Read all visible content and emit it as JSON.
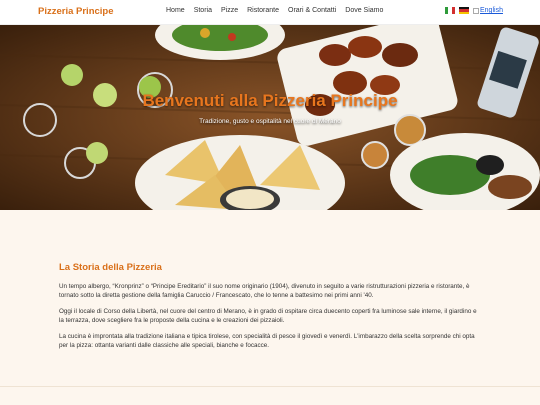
{
  "header": {
    "brand": "Pizzeria Principe",
    "nav": [
      "Home",
      "Storia",
      "Pizze",
      "Ristorante",
      "Orari & Contatti",
      "Dove Siamo"
    ],
    "lang_english": "English"
  },
  "hero": {
    "title": "Benvenuti alla Pizzeria Principe",
    "subtitle": "Tradizione, gusto e ospitalità nel cuore di Merano"
  },
  "story": {
    "title": "La Storia della Pizzeria",
    "paragraphs": [
      "Un tempo albergo, “Kronprinz” o “Principe Ereditario” il suo nome originario (1904), divenuto in seguito a varie ristrutturazioni pizzeria e ristorante, è tornato sotto la diretta gestione della famiglia Caruccio / Francescato, che lo tenne a battesimo nei primi anni '40.",
      "Oggi il locale di Corso della Libertà, nel cuore del centro di Merano, è in grado di ospitare circa duecento coperti fra luminose sale interne, il giardino e la terrazza, dove scegliere fra le proposte della cucina e le creazioni dei pizzaioli.",
      "La cucina è improntata alla tradizione italiana e tipica tirolese, con specialità di pesce il giovedì e venerdì. L'imbarazzo della scelta sorprende chi opta per la pizza: ottanta varianti dalle classiche alle speciali, bianche e focacce."
    ]
  },
  "colors": {
    "accent": "#d9701a",
    "background": "#fdf6ee"
  }
}
